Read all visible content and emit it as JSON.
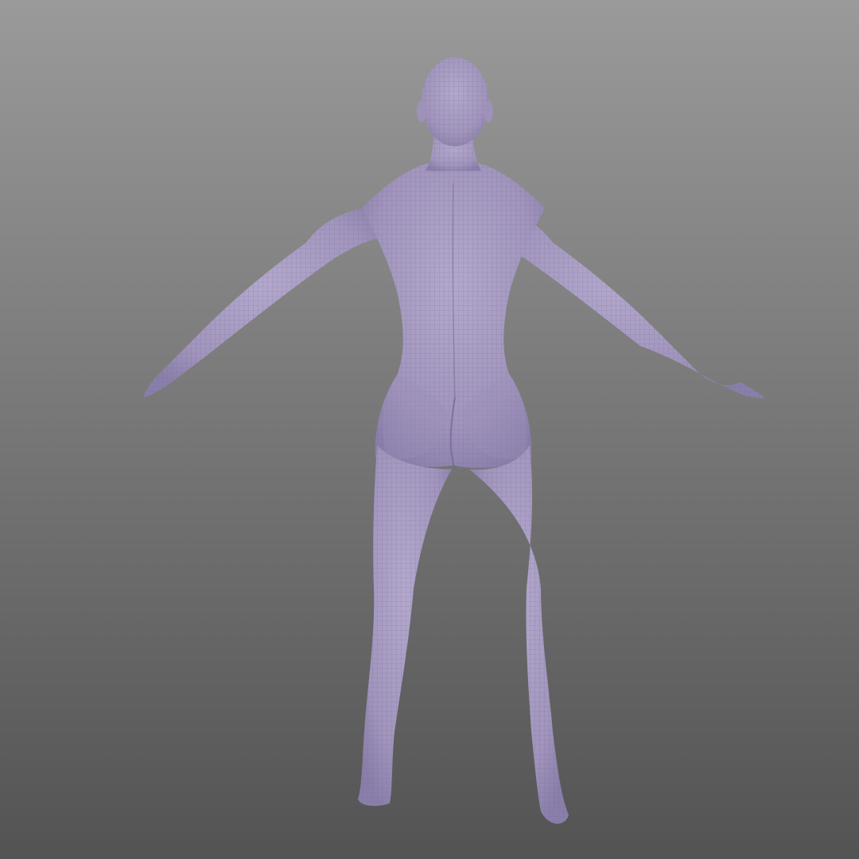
{
  "viewport": {
    "background_top": "#9a9a9a",
    "background_bottom": "#535353"
  },
  "model": {
    "view": "back",
    "pose": "A-pose",
    "display_mode": "wireframe-on-shaded",
    "surface_color": "#a89cc2",
    "wire_color": "#6e6390",
    "shade_color": "#8a7faa"
  }
}
